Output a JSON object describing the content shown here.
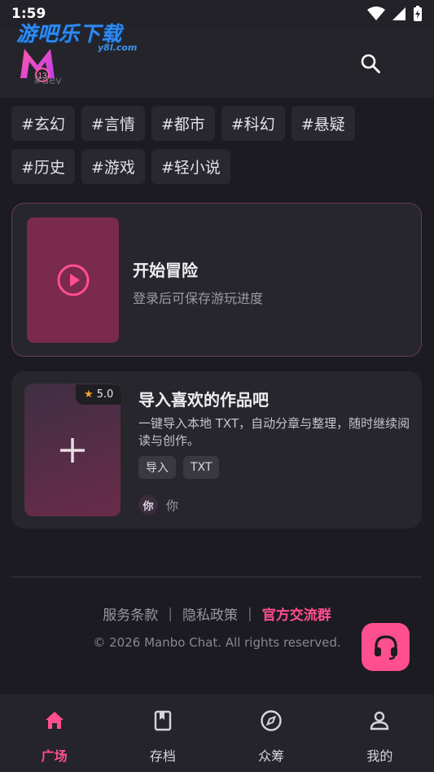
{
  "status": {
    "time": "1:59"
  },
  "header": {
    "watermark_text": "游吧乐下载",
    "watermark_sub": "y8l.com",
    "logo_badge": "13",
    "dev_tag": "#dev",
    "search_icon": "search-icon"
  },
  "tags": [
    "#玄幻",
    "#言情",
    "#都市",
    "#科幻",
    "#悬疑",
    "#历史",
    "#游戏",
    "#轻小说"
  ],
  "adventure": {
    "title": "开始冒险",
    "subtitle": "登录后可保存游玩进度",
    "icon": "play-icon"
  },
  "import_card": {
    "rating": "5.0",
    "title": "导入喜欢的作品吧",
    "description": "一键导入本地 TXT，自动分章与整理，随时继续阅读与创作。",
    "chips": [
      "导入",
      "TXT"
    ],
    "author_avatar": "你",
    "author_name": "你",
    "icon": "plus-icon"
  },
  "footer": {
    "terms": "服务条款",
    "privacy": "隐私政策",
    "community": "官方交流群",
    "separator": "|",
    "copyright": "© 2026 Manbo Chat. All rights reserved."
  },
  "nav": [
    {
      "label": "广场",
      "icon": "home-icon",
      "active": true
    },
    {
      "label": "存档",
      "icon": "bookmark-icon",
      "active": false
    },
    {
      "label": "众筹",
      "icon": "compass-icon",
      "active": false
    },
    {
      "label": "我的",
      "icon": "user-icon",
      "active": false
    }
  ],
  "colors": {
    "accent": "#ff4f8f",
    "background": "#1c1b21",
    "card": "#27262c",
    "thumb": "#7a2a4c"
  }
}
